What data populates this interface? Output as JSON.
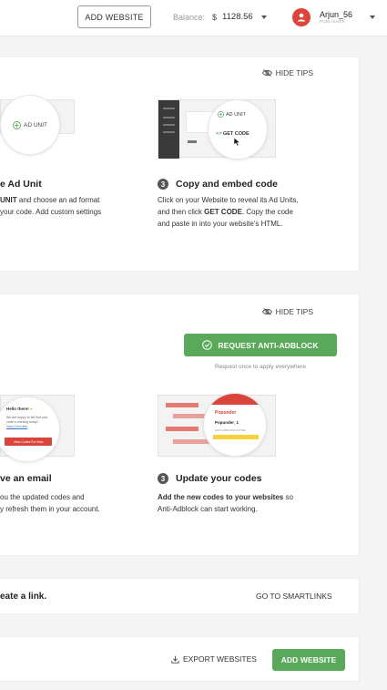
{
  "header": {
    "add_website_label": "ADD WEBSITE",
    "balance_label": "Balance:",
    "currency": "$",
    "balance_amount": "1128.56",
    "user_name": "Arjun_56",
    "user_role": "PUBLISHER"
  },
  "tips_card": {
    "hide_tips_label": "HIDE TIPS",
    "step2": {
      "illus_label": "AD UNIT",
      "title": "e Ad Unit",
      "line1_bold": "UNIT",
      "line1_rest": " and choose an ad format",
      "line2": "your code. Add custom settings"
    },
    "step3": {
      "number": "3",
      "illus_ad_unit": "AD UNIT",
      "illus_get_code": "GET CODE",
      "title": "Copy and embed code",
      "line1": "Click on your Website to reveal its Ad Units,",
      "line2_pre": "and then click ",
      "line2_bold": "GET CODE",
      "line2_post": ". Copy the code",
      "line3": "and paste in into your website's HTML."
    }
  },
  "antiadblock_card": {
    "hide_tips_label": "HIDE TIPS",
    "request_button": "REQUEST ANTI-ADBLOCK",
    "request_note": "Request once to apply everywhere",
    "step2": {
      "illus_greeting": "Hello there!",
      "illus_line1": "We are happy to tell that your",
      "illus_line2": "code is working today!",
      "illus_link": "View Overview",
      "illus_button": "View Codes For Now",
      "title": "ve an email",
      "line1": "ou the updated codes and",
      "line2": "y refresh them in your account."
    },
    "step3": {
      "number": "3",
      "illus_brand": "Popunder",
      "illus_item": "Popunder_1",
      "illus_small": "ANTI-ADBLOCK ACTIVE",
      "title": "Update your codes",
      "line1_bold": "Add the new codes to your websites",
      "line1_rest": " so",
      "line2": "Anti-Adblock can start working."
    }
  },
  "smartlink_card": {
    "text": "eate a link.",
    "go_label": "GO TO SMARTLINKS"
  },
  "websites_card": {
    "export_label": "EXPORT WEBSITES",
    "add_label": "ADD WEBSITE"
  },
  "colors": {
    "accent_green": "#5aa95a",
    "avatar_red": "#e0433a",
    "popunder_red": "#d9453b"
  }
}
